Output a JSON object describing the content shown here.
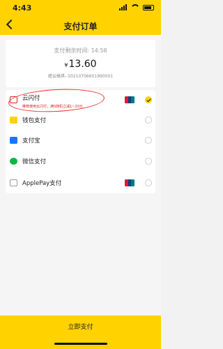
{
  "status": {
    "time": "4:43"
  },
  "nav": {
    "title": "支付订单"
  },
  "order": {
    "timer": "支付剩余时间: 14:58",
    "currency": "¥",
    "amount": "13.60",
    "order_no": "缇云搞琪--50210706601990001"
  },
  "methods": [
    {
      "label": "云闪付",
      "promo": "推荐使用云闪付，满5随机立减1~20元",
      "selected": true,
      "unionpay": true
    },
    {
      "label": "钱包支付",
      "selected": false,
      "unionpay": false
    },
    {
      "label": "支付宝",
      "selected": false,
      "unionpay": false
    },
    {
      "label": "微信支付",
      "selected": false,
      "unionpay": false
    },
    {
      "label": "ApplePay支付",
      "selected": false,
      "unionpay": true
    }
  ],
  "footer": {
    "pay_label": "立即支付"
  },
  "colors": {
    "brand": "#ffd200",
    "annotation": "#e53131"
  }
}
